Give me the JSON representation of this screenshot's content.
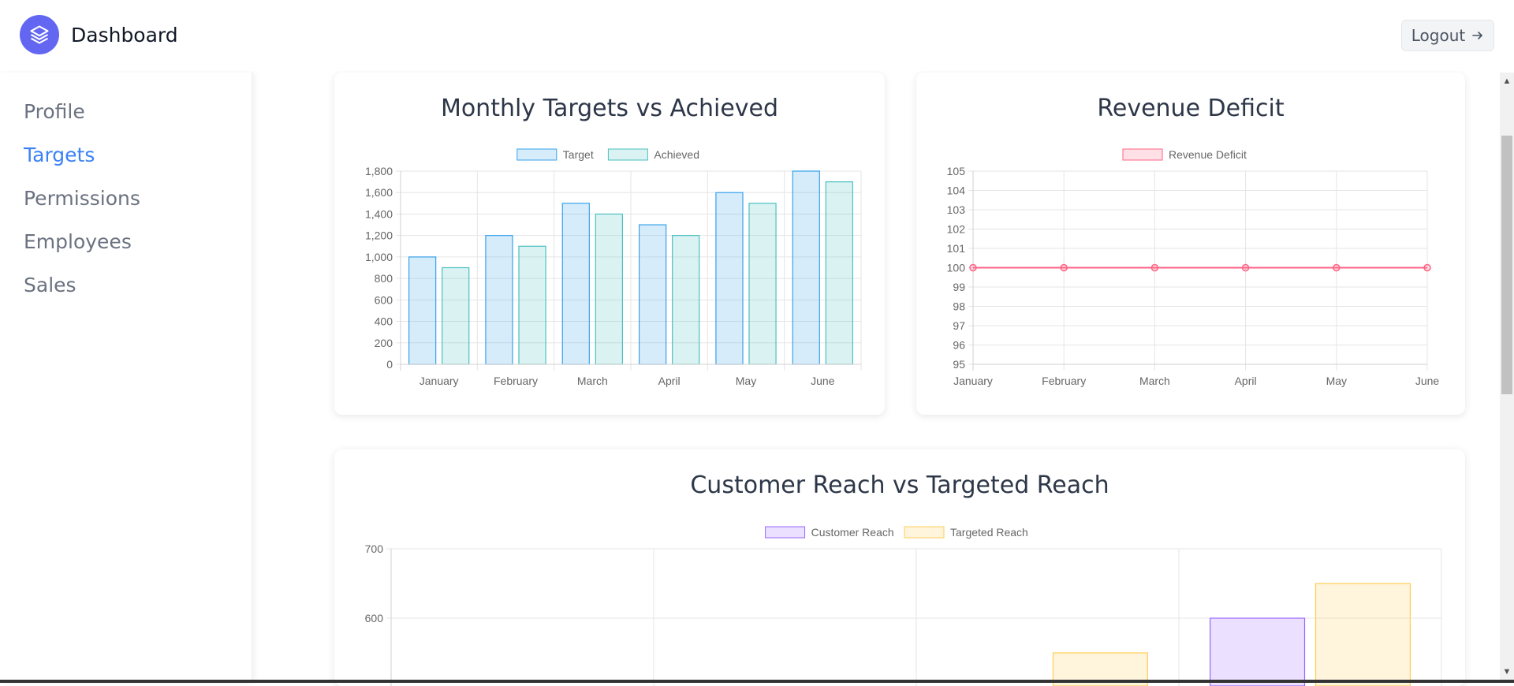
{
  "header": {
    "brand": "Dashboard",
    "logout_label": "Logout",
    "logo_icon": "layers-icon",
    "logout_icon": "arrow-right-icon"
  },
  "sidebar": {
    "items": [
      {
        "label": "Profile",
        "active": false
      },
      {
        "label": "Targets",
        "active": true
      },
      {
        "label": "Permissions",
        "active": false
      },
      {
        "label": "Employees",
        "active": false
      },
      {
        "label": "Sales",
        "active": false
      }
    ]
  },
  "colors": {
    "accent": "#3b82f6",
    "logo": "#6366f1",
    "target": "#36a2eb",
    "achieved": "#4bc0c0",
    "deficit": "#ff6384",
    "customer": "#9966ff",
    "targeted": "#ffcd56"
  },
  "chart_data": [
    {
      "type": "bar",
      "title": "Monthly Targets vs Achieved",
      "categories": [
        "January",
        "February",
        "March",
        "April",
        "May",
        "June"
      ],
      "series": [
        {
          "name": "Target",
          "values": [
            1000,
            1200,
            1500,
            1300,
            1600,
            1800
          ]
        },
        {
          "name": "Achieved",
          "values": [
            900,
            1100,
            1400,
            1200,
            1500,
            1700
          ]
        }
      ],
      "ylim": [
        0,
        1800
      ],
      "yticks": [
        "1,800",
        "1,600",
        "1,400",
        "1,200",
        "1,000",
        "800",
        "600",
        "400",
        "200",
        "0"
      ],
      "legend": "top",
      "grid": true
    },
    {
      "type": "line",
      "title": "Revenue Deficit",
      "categories": [
        "January",
        "February",
        "March",
        "April",
        "May",
        "June"
      ],
      "series": [
        {
          "name": "Revenue Deficit",
          "values": [
            100,
            100,
            100,
            100,
            100,
            100
          ]
        }
      ],
      "ylim": [
        95,
        105
      ],
      "yticks": [
        "105",
        "104",
        "103",
        "102",
        "101",
        "100",
        "99",
        "98",
        "97",
        "96",
        "95"
      ],
      "legend": "top",
      "grid": true
    },
    {
      "type": "bar",
      "title": "Customer Reach vs Targeted Reach",
      "categories": [
        "",
        "",
        "",
        ""
      ],
      "series": [
        {
          "name": "Customer Reach",
          "values": [
            null,
            null,
            null,
            600
          ]
        },
        {
          "name": "Targeted Reach",
          "values": [
            null,
            null,
            550,
            650
          ]
        }
      ],
      "yticks": [
        "700",
        "600"
      ],
      "visible_ylim": [
        700,
        600
      ],
      "legend": "top",
      "grid": true
    }
  ]
}
